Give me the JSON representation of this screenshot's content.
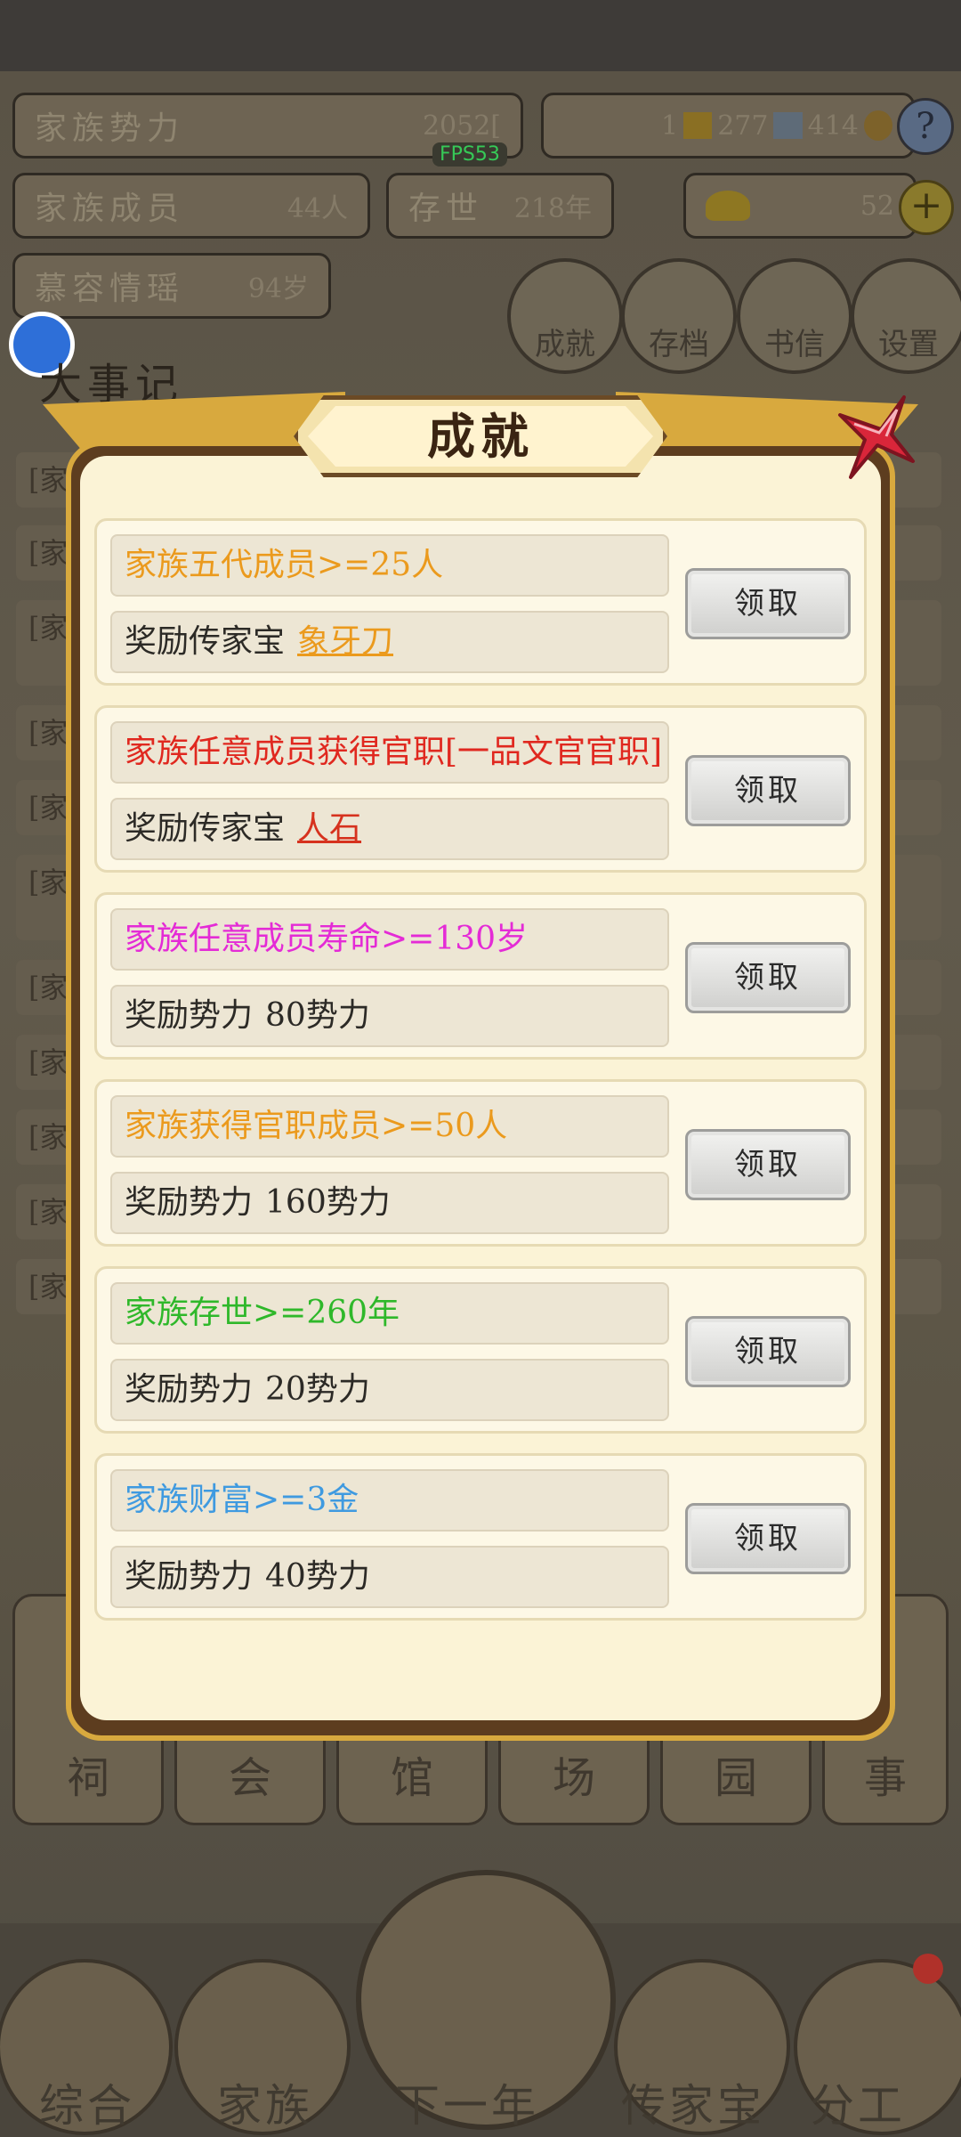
{
  "hud": {
    "power_label": "家族势力",
    "power_value": "2052[",
    "power_tag": "",
    "members_label": "家族成员",
    "members_value": "44人",
    "exist_label": "存世",
    "exist_value": "218年",
    "age_label": "慕容情瑶",
    "age_value": "94岁",
    "gold_count": "1",
    "silver_count": "277",
    "gem_count": "414",
    "ingot_count": "52",
    "fps": "FPS53",
    "help": "?",
    "plus": "+",
    "circle_buttons": [
      "成就",
      "存档",
      "书信",
      "设置"
    ],
    "events_title": "大事记"
  },
  "events": [
    "[家",
    "[家",
    "[家",
    "[家",
    "[家",
    "[家",
    "[家",
    "[家",
    "[家",
    "[家",
    "[家"
  ],
  "grid_tiles": [
    "祠",
    "会",
    "馆",
    "场",
    "园",
    "事"
  ],
  "bottom_nav": [
    "综合",
    "家族",
    "下一年",
    "传家宝",
    "分工"
  ],
  "colors": {
    "orange": "#eb9a1d",
    "red": "#e0281f",
    "magenta": "#e42bd6",
    "green": "#2fb82a",
    "blue": "#3f9ae0",
    "reward_link_red": "#d6321e",
    "close_x": "#d9263a"
  },
  "dialog": {
    "title": "成就",
    "claim_label": "领取",
    "achievements": [
      {
        "condition": "家族五代成员>=25人",
        "reward_prefix": "奖励传家宝",
        "reward_item": "象牙刀"
      },
      {
        "condition": "家族任意成员获得官职[一品文官官职]",
        "reward_prefix": "奖励传家宝",
        "reward_item": "人石"
      },
      {
        "condition": "家族任意成员寿命>=130岁",
        "reward_prefix": "奖励势力",
        "reward_item": "80势力"
      },
      {
        "condition": "家族获得官职成员>=50人",
        "reward_prefix": "奖励势力",
        "reward_item": "160势力"
      },
      {
        "condition": "家族存世>=260年",
        "reward_prefix": "奖励势力",
        "reward_item": "20势力"
      },
      {
        "condition": "家族财富>=3金",
        "reward_prefix": "奖励势力",
        "reward_item": "40势力"
      }
    ]
  }
}
